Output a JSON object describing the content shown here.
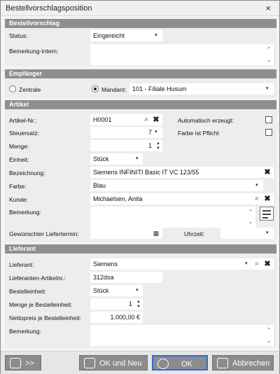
{
  "window": {
    "title": "Bestellvorschlagsposition",
    "close_glyph": "×"
  },
  "sections": {
    "bestellvorschlag": "Bestellvorschlag",
    "empfaenger": "Empfänger",
    "artikel": "Artikel",
    "lieferant": "Lieferant"
  },
  "bestellvorschlag": {
    "status_label": "Status:",
    "status_value": "Eingereicht",
    "bemerkung_intern_label": "Bemerkung-Intern:",
    "bemerkung_intern_value": ""
  },
  "empfaenger": {
    "zentrale_label": "Zentrale",
    "mandant_label": "Mandant:",
    "mandant_value": "101 - Filiale Husum",
    "selected": "mandant"
  },
  "artikel": {
    "artikel_nr_label": "Artikel-Nr.:",
    "artikel_nr_value": "H0001",
    "auto_label": "Automatisch erzeugt:",
    "steuersatz_label": "Steuersatz:",
    "steuersatz_value": "7",
    "farbe_pflicht_label": "Farbe ist Pflicht",
    "menge_label": "Menge:",
    "menge_value": "1",
    "einheit_label": "Einheit:",
    "einheit_value": "Stück",
    "bezeichnung_label": "Bezeichnung:",
    "bezeichnung_value": "Siemens INFINITI Basic IT VC 123/55",
    "farbe_label": "Farbe:",
    "farbe_value": "Blau",
    "kunde_label": "Kunde:",
    "kunde_value": "Michaelsen, Anita",
    "bemerkung_label": "Bemerkung:",
    "bemerkung_value": "",
    "liefertermin_label": "Gewünschter Liefertermin:",
    "liefertermin_value": "",
    "uhrzeit_label": "Uhrzeit:",
    "uhrzeit_value": ""
  },
  "lieferant": {
    "lieferant_label": "Lieferant:",
    "lieferant_value": "Siemens",
    "artikelnr_label": "Lieferanten-Artikelnr.:",
    "artikelnr_value": "312dsa",
    "bestelleinheit_label": "Bestelleinheit:",
    "bestelleinheit_value": "Stück",
    "menge_je_label": "Menge je Bestelleinheit:",
    "menge_je_value": "1",
    "nettopreis_label": "Nettopreis je Bestelleinheit:",
    "nettopreis_value": "1.000,00 €",
    "bemerkung_label": "Bemerkung:",
    "bemerkung_value": ""
  },
  "buttons": {
    "more_label": ">>",
    "ok_neu_label": "OK und Neu",
    "ok_label": "OK",
    "abbrechen_label": "Abbrechen"
  },
  "icons": {
    "dropdown": "▾",
    "search": "⌕",
    "clear": "✖",
    "spin_up": "▲",
    "spin_down": "▼",
    "calendar": "▦",
    "scroll_up": "▴",
    "scroll_down": "▾"
  },
  "colors": {
    "section_header": "#8f8f8f",
    "button": "#8c8c8c",
    "focus_border": "#2a6cd6"
  }
}
